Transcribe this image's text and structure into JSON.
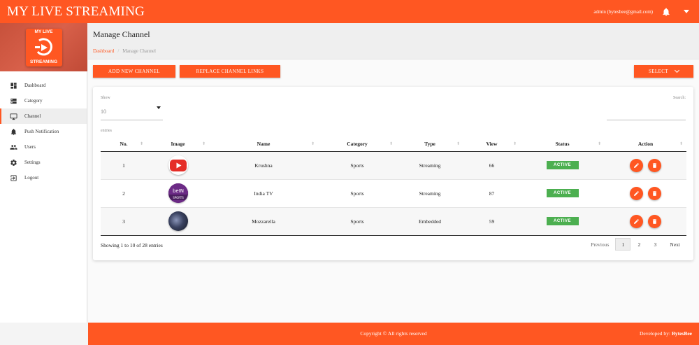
{
  "header": {
    "app_title": "MY LIVE STREAMING",
    "admin_text": "admin (bytesbee@gmail.com)",
    "bell_icon": "bell-icon",
    "menu_icon": "caret-down-icon",
    "brand_color": "#ff5722"
  },
  "sidebar": {
    "logo_top": "MY LIVE",
    "logo_bottom": "STREAMING",
    "items": [
      {
        "label": "Dashboard",
        "icon": "dashboard-icon"
      },
      {
        "label": "Category",
        "icon": "category-icon"
      },
      {
        "label": "Channel",
        "icon": "monitor-icon",
        "active": true
      },
      {
        "label": "Push Notification",
        "icon": "bell-icon"
      },
      {
        "label": "Users",
        "icon": "users-icon"
      },
      {
        "label": "Settings",
        "icon": "gear-icon"
      },
      {
        "label": "Logout",
        "icon": "logout-icon"
      }
    ]
  },
  "page": {
    "title": "Manage Channel",
    "breadcrumb": [
      "Dashboard",
      "Manage Channel"
    ]
  },
  "toolbar": {
    "add_label": "ADD NEW CHANNEL",
    "replace_label": "REPLACE CHANNEL LINKS",
    "select_label": "SELECT"
  },
  "table_controls": {
    "show_label": "Show",
    "show_value": "10",
    "entries_label": "entries",
    "search_label": "Search:",
    "search_value": ""
  },
  "table": {
    "columns": [
      "No.",
      "Image",
      "Name",
      "Category",
      "Type",
      "View",
      "Status",
      "Action"
    ],
    "rows": [
      {
        "no": "1",
        "image": "youtube-logo",
        "name": "Krushna",
        "category": "Sports",
        "type": "Streaming",
        "view": "66",
        "status": "ACTIVE"
      },
      {
        "no": "2",
        "image": "bein-sports-logo",
        "name": "India TV",
        "category": "Sports",
        "type": "Streaming",
        "view": "87",
        "status": "ACTIVE"
      },
      {
        "no": "3",
        "image": "planet-image",
        "name": "Mozzarella",
        "category": "Sports",
        "type": "Embedded",
        "view": "59",
        "status": "ACTIVE"
      }
    ]
  },
  "pagination": {
    "info": "Showing 1 to 10 of 28 entries",
    "previous": "Previous",
    "pages": [
      "1",
      "2",
      "3"
    ],
    "current": "1",
    "next": "Next"
  },
  "footer": {
    "copyright": "Copyright © All rights reserved",
    "developed_by_label": "Developed by:",
    "developer": "BytesBee"
  },
  "colors": {
    "accent": "#ff5722",
    "status_active": "#4caf50"
  }
}
